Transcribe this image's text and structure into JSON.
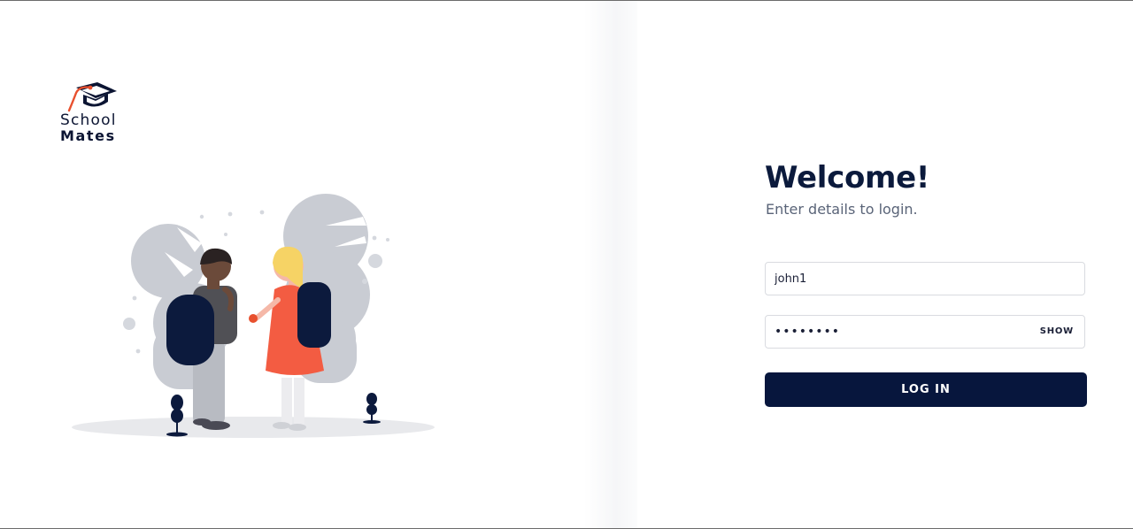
{
  "brand": {
    "name_line1": "School",
    "name_line2": "Mates",
    "icon": "graduation-cap-logo",
    "accent_color": "#e8502e",
    "primary_color": "#0c1533"
  },
  "illustration": {
    "icon": "students-illustration",
    "colors": {
      "backpack": "#0c1a3d",
      "dress": "#f35c42",
      "hair": "#f6d365",
      "shrub": "#c9ccd3",
      "ground": "#e8e9ec"
    }
  },
  "login": {
    "title": "Welcome!",
    "subtitle": "Enter details to login.",
    "username_value": "john1",
    "password_value": "••••••••",
    "show_label": "SHOW",
    "submit_label": "LOG IN",
    "button_color": "#07163d"
  }
}
